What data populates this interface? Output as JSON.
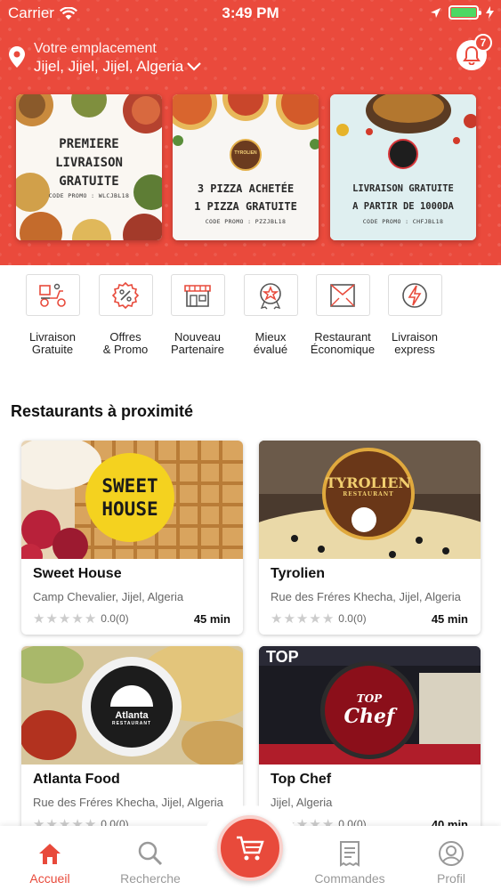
{
  "status_bar": {
    "carrier": "Carrier",
    "time": "3:49 PM"
  },
  "header": {
    "location_label": "Votre emplacement",
    "location_value": "Jijel, Jijel, Jijel, Algeria",
    "notification_count": "7"
  },
  "promos": [
    {
      "line1": "PREMIERE",
      "line2": "LIVRAISON",
      "line3": "GRATUITE",
      "code": "CODE PROMO : WLCJBL18"
    },
    {
      "logo_text": "TYROLIEN",
      "line1": "3 PIZZA ACHETÉE",
      "line2": "1 PIZZA GRATUITE",
      "code": "CODE PROMO : PZZJBL18"
    },
    {
      "line1": "LIVRAISON GRATUITE",
      "line2": "A PARTIR DE 1000DA",
      "code": "CODE PROMO : CHFJBL18"
    }
  ],
  "categories": [
    {
      "line1": "Livraison",
      "line2": "Gratuite",
      "icon": "delivery-scooter-icon"
    },
    {
      "line1": "Offres",
      "line2": "& Promo",
      "icon": "discount-badge-icon"
    },
    {
      "line1": "Nouveau",
      "line2": "Partenaire",
      "icon": "storefront-icon"
    },
    {
      "line1": "Mieux",
      "line2": "évalué",
      "icon": "star-award-icon"
    },
    {
      "line1": "Restaurant",
      "line2": "Économique",
      "icon": "wallet-icon"
    },
    {
      "line1": "Livraison",
      "line2": "express",
      "icon": "lightning-icon"
    }
  ],
  "section_title": "Restaurants à proximité",
  "restaurants": [
    {
      "name": "Sweet House",
      "address": "Camp Chevalier, Jijel, Algeria",
      "rating": "0.0(0)",
      "time": "45 min",
      "logo_line1": "SWEET",
      "logo_line2": "HOUSE"
    },
    {
      "name": "Tyrolien",
      "address": "Rue des Fréres Khecha, Jijel, Algeria",
      "rating": "0.0(0)",
      "time": "45 min",
      "logo_line1": "TYROLIEN",
      "logo_line2": "RESTAURANT"
    },
    {
      "name": "Atlanta Food",
      "address": "Rue des Fréres Khecha, Jijel, Algeria",
      "rating": "0.0(0)",
      "time": "",
      "logo_line1": "Atlanta",
      "logo_line2": "RESTAURANT"
    },
    {
      "name": "Top Chef",
      "address": "Jijel, Algeria",
      "rating": "0.0(0)",
      "time": "40 min",
      "logo_line1": "TOP",
      "logo_line2": "Chef",
      "sign": "TOP"
    }
  ],
  "tabs": [
    {
      "label": "Accueil",
      "icon": "home-icon",
      "active": true
    },
    {
      "label": "Recherche",
      "icon": "search-icon"
    },
    {
      "label": "",
      "icon": "cart-icon"
    },
    {
      "label": "Commandes",
      "icon": "receipt-icon"
    },
    {
      "label": "Profil",
      "icon": "profile-icon"
    }
  ],
  "colors": {
    "brand": "#ea4a3c",
    "star": "#cccccc"
  }
}
